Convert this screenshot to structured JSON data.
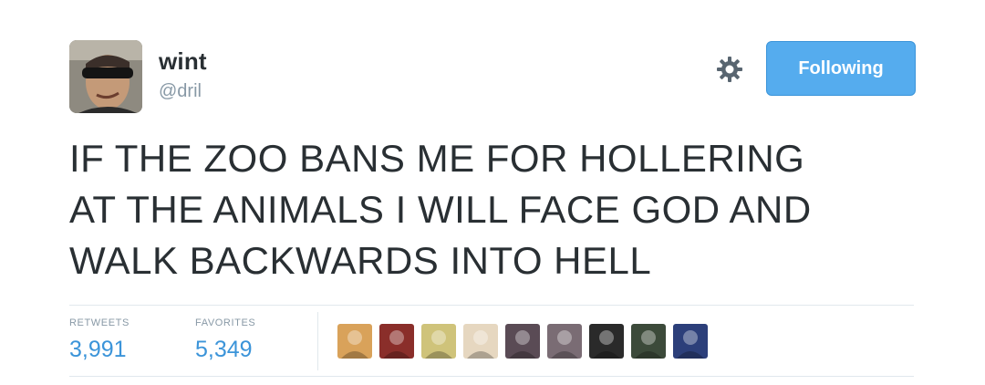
{
  "user": {
    "display_name": "wint",
    "handle": "@dril"
  },
  "actions": {
    "follow_label": "Following",
    "settings_icon": "gear-icon"
  },
  "tweet": {
    "lines": [
      "IF THE ZOO BANS ME FOR HOLLERING",
      "AT THE ANIMALS I WILL FACE GOD AND",
      "WALK BACKWARDS INTO HELL"
    ]
  },
  "stats": {
    "retweets_label": "RETWEETS",
    "retweets_value": "3,991",
    "favorites_label": "FAVORITES",
    "favorites_value": "5,349"
  },
  "favoriters": [
    {
      "name": "favoriter-avatar-1",
      "color": "#d9a25a"
    },
    {
      "name": "favoriter-avatar-2",
      "color": "#8a2e2a"
    },
    {
      "name": "favoriter-avatar-3",
      "color": "#cfc37a"
    },
    {
      "name": "favoriter-avatar-4",
      "color": "#e6d7c0"
    },
    {
      "name": "favoriter-avatar-5",
      "color": "#5a4b55"
    },
    {
      "name": "favoriter-avatar-6",
      "color": "#7a6c74"
    },
    {
      "name": "favoriter-avatar-7",
      "color": "#2a2a2a"
    },
    {
      "name": "favoriter-avatar-8",
      "color": "#3c4a3a"
    },
    {
      "name": "favoriter-avatar-9",
      "color": "#2c3f7a"
    }
  ],
  "colors": {
    "accent": "#55acee",
    "link": "#3b94d9",
    "text": "#292f33",
    "muted": "#8899a6"
  }
}
